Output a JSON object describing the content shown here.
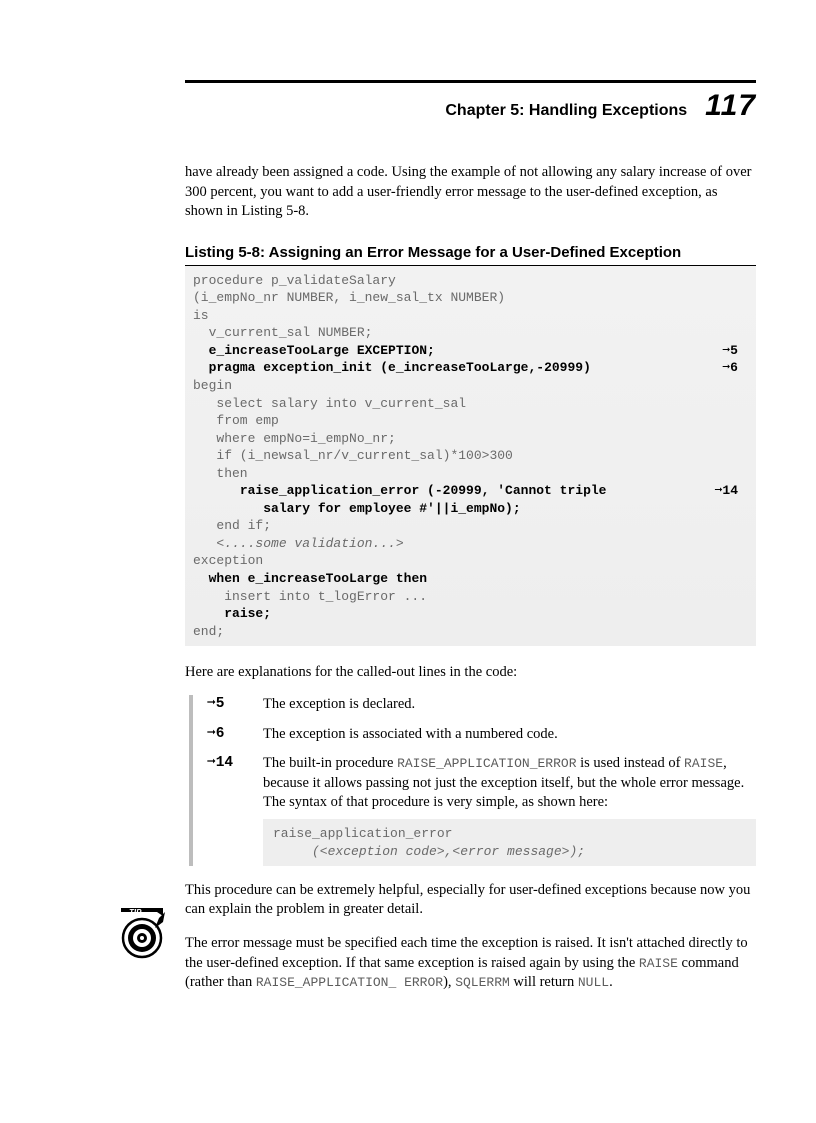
{
  "header": {
    "chapter": "Chapter 5: Handling Exceptions",
    "page": "117"
  },
  "intro": "have already been assigned a code. Using the example of not allowing any salary increase of over 300 percent, you want to add a user-friendly error message to the user-defined exception, as shown in Listing 5-8.",
  "listing": {
    "title": "Listing 5-8:    Assigning an Error Message for a User-Defined Exception",
    "lines": [
      {
        "text": "procedure p_validateSalary"
      },
      {
        "text": "(i_empNo_nr NUMBER, i_new_sal_tx NUMBER)"
      },
      {
        "text": "is"
      },
      {
        "text": "  v_current_sal NUMBER;"
      },
      {
        "text": "  ",
        "bold": "e_increaseTooLarge EXCEPTION;",
        "callout": "➞5"
      },
      {
        "text": "  ",
        "bold": "pragma exception_init (e_increaseTooLarge,-20999)",
        "callout": "➞6"
      },
      {
        "text": "begin"
      },
      {
        "text": "   select salary into v_current_sal"
      },
      {
        "text": "   from emp"
      },
      {
        "text": "   where empNo=i_empNo_nr;"
      },
      {
        "text": "   if (i_newsal_nr/v_current_sal)*100>300"
      },
      {
        "text": "   then"
      },
      {
        "text": "      ",
        "bold": "raise_application_error (-20999, 'Cannot triple",
        "callout": "➞14"
      },
      {
        "text": "         ",
        "bold": "salary for employee #'||i_empNo);"
      },
      {
        "text": "   end if;"
      },
      {
        "text": "   ",
        "italic": "<....some validation...>"
      },
      {
        "text": "exception"
      },
      {
        "text": "  ",
        "bold": "when e_increaseTooLarge then"
      },
      {
        "text": "    insert into t_logError ..."
      },
      {
        "text": "    ",
        "bold": "raise;"
      },
      {
        "text": "end;"
      }
    ]
  },
  "explain_intro": "Here are explanations for the called-out lines in the code:",
  "callouts": [
    {
      "marker": "➞5",
      "text": "The exception is declared."
    },
    {
      "marker": "➞6",
      "text": "The exception is associated with a numbered code."
    },
    {
      "marker": "➞14",
      "pre": "The built-in procedure ",
      "code1": "RAISE_APPLICATION_ERROR",
      "mid": " is used instead of ",
      "code2": "RAISE",
      "post": ", because it allows passing not just the exception itself, but the whole error message. The syntax of that procedure is very simple, as shown here:"
    }
  ],
  "syntax_example": {
    "line1": "raise_application_error",
    "line2": "     (<exception code>,<error message>);"
  },
  "tip_para": "This procedure can be extremely helpful, especially for user-defined exceptions because now you can explain the problem in greater detail.",
  "final_para": {
    "p1": "The error message must be specified each time the exception is raised. It isn't attached directly to the user-defined exception. If that same exception is raised again by using the ",
    "c1": "RAISE",
    "p2": " command (rather than ",
    "c2": "RAISE_APPLICATION_ ERROR",
    "p3": "), ",
    "c3": "SQLERRM",
    "p4": " will return ",
    "c4": "NULL",
    "p5": "."
  }
}
